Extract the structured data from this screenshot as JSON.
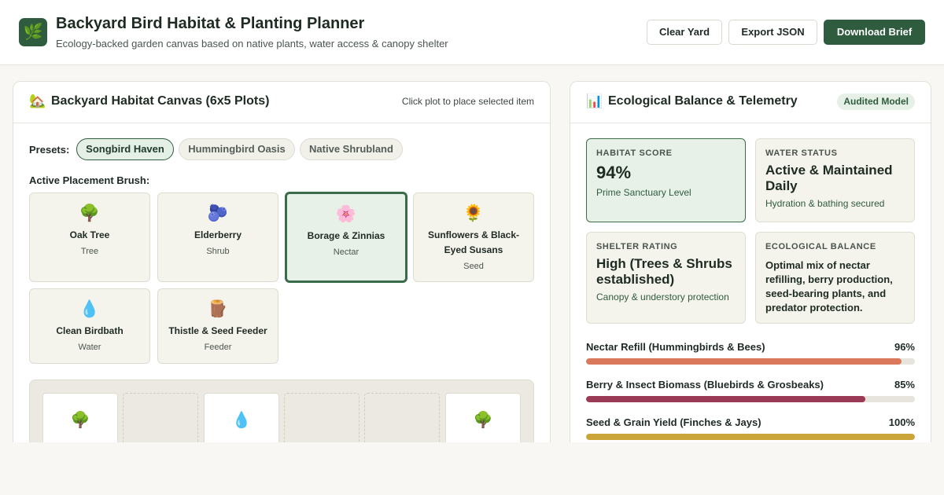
{
  "header": {
    "logo_icon": "leaf-icon",
    "title": "Backyard Bird Habitat & Planting Planner",
    "subtitle": "Ecology-backed garden canvas based on native plants, water access & canopy shelter",
    "buttons": {
      "clear": "Clear Yard",
      "export": "Export JSON",
      "download": "Download Brief"
    },
    "accent": "#2f5b3f"
  },
  "canvas": {
    "icon": "house-with-garden-icon",
    "title": "Backyard Habitat Canvas (6x5 Plots)",
    "hint": "Click plot to place selected item",
    "presets_label": "Presets:",
    "presets": [
      "Songbird Haven",
      "Hummingbird Oasis",
      "Native Shrubland"
    ],
    "active_preset": "Songbird Haven",
    "brush_label": "Active Placement Brush:",
    "brushes": [
      {
        "emoji": "🌳",
        "name": "Oak Tree",
        "category": "Tree"
      },
      {
        "emoji": "🫐",
        "name": "Elderberry",
        "category": "Shrub"
      },
      {
        "emoji": "🌸",
        "name": "Borage & Zinnias",
        "category": "Nectar"
      },
      {
        "emoji": "🌻",
        "name": "Sunflowers & Black-Eyed Susans",
        "category": "Seed"
      },
      {
        "emoji": "💧",
        "name": "Clean Birdbath",
        "category": "Water"
      },
      {
        "emoji": "🪵",
        "name": "Thistle & Seed Feeder",
        "category": "Feeder"
      }
    ],
    "selected_brush": "Borage & Zinnias",
    "plots_row1": [
      "🌳",
      "",
      "💧",
      "",
      "",
      "🌳"
    ]
  },
  "telemetry": {
    "icon": "bar-chart-icon",
    "title": "Ecological Balance & Telemetry",
    "badge": "Audited Model",
    "stats": {
      "habitat": {
        "label": "Habitat Score",
        "value": "94%",
        "note": "Prime Sanctuary Level"
      },
      "water": {
        "label": "Water Status",
        "value": "Active & Maintained Daily",
        "note": "Hydration & bathing secured"
      },
      "shelter": {
        "label": "Shelter Rating",
        "value": "High (Trees & Shrubs established)",
        "note": "Canopy & understory protection"
      },
      "balance": {
        "label": "Ecological Balance",
        "value": "Optimal mix of nectar refilling, berry production, seed-bearing plants, and predator protection."
      }
    },
    "metrics": [
      {
        "label": "Nectar Refill (Hummingbirds & Bees)",
        "pct": "96%",
        "value": 96,
        "color": "#d9785a"
      },
      {
        "label": "Berry & Insect Biomass (Bluebirds & Grosbeaks)",
        "pct": "85%",
        "value": 85,
        "color": "#9b3a57"
      },
      {
        "label": "Seed & Grain Yield (Finches & Jays)",
        "pct": "100%",
        "value": 100,
        "color": "#c9a53a"
      }
    ]
  }
}
